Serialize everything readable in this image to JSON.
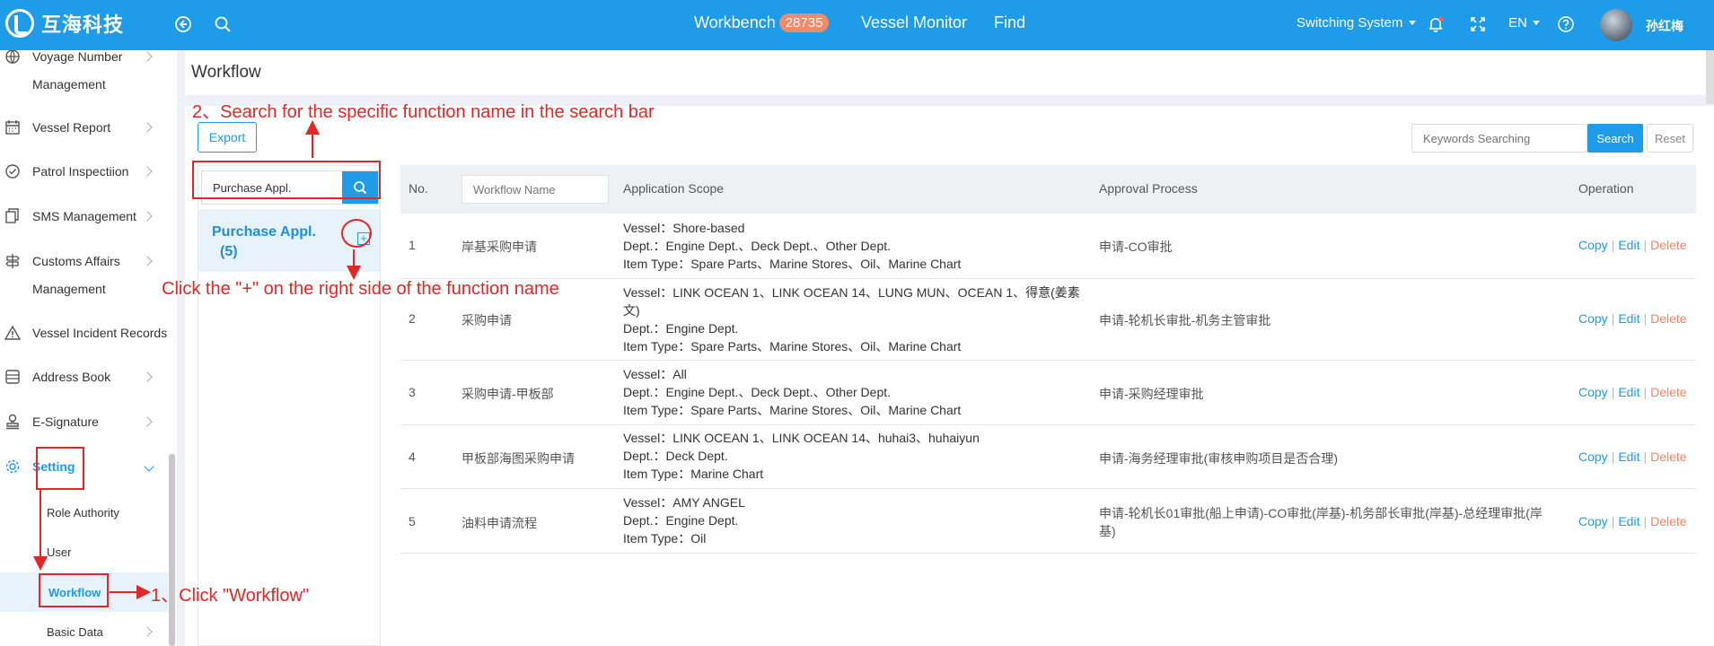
{
  "header": {
    "logo_text": "互海科技",
    "nav": {
      "workbench": "Workbench",
      "workbench_count": "28735",
      "vessel_monitor": "Vessel Monitor",
      "find": "Find"
    },
    "switching_system": "Switching System",
    "lang": "EN",
    "user_name": "孙红梅"
  },
  "sidebar": {
    "items": [
      {
        "label": "Voyage Number",
        "label2": "Management"
      },
      {
        "label": "Vessel Report"
      },
      {
        "label": "Patrol Inspectiion"
      },
      {
        "label": "SMS Management"
      },
      {
        "label": "Customs Affairs",
        "label2": "Management"
      },
      {
        "label": "Vessel Incident Records"
      },
      {
        "label": "Address Book"
      },
      {
        "label": "E-Signature"
      },
      {
        "label": "Setting"
      }
    ],
    "sub_items": [
      "Role Authority",
      "User",
      "Workflow",
      "Basic Data"
    ]
  },
  "page": {
    "title": "Workflow"
  },
  "toolbar": {
    "export_label": "Export",
    "keyword_placeholder": "Keywords Searching",
    "search_label": "Search",
    "reset_label": "Reset"
  },
  "function_panel": {
    "search_value": "Purchase Appl.",
    "item_name": "Purchase Appl.",
    "item_count": "(5)",
    "plus_symbol": "+"
  },
  "table": {
    "headers": {
      "no": "No.",
      "workflow_name_placeholder": "Workflow Name",
      "scope": "Application Scope",
      "approval": "Approval Process",
      "operation": "Operation"
    },
    "ops": {
      "copy": "Copy",
      "edit": "Edit",
      "delete": "Delete",
      "sep": "|"
    },
    "rows": [
      {
        "no": "1",
        "name": "岸基采购申请",
        "scope": [
          "Vessel：Shore-based",
          "Dept.：Engine Dept.、Deck Dept.、Other Dept.",
          "Item Type：Spare Parts、Marine Stores、Oil、Marine Chart"
        ],
        "approval": "申请-CO审批"
      },
      {
        "no": "2",
        "name": "采购申请",
        "scope": [
          "Vessel：LINK OCEAN 1、LINK OCEAN 14、LUNG MUN、OCEAN 1、得意(姜素",
          "文)",
          "Dept.：Engine Dept.",
          "Item Type：Spare Parts、Marine Stores、Oil、Marine Chart"
        ],
        "approval": "申请-轮机长审批-机务主管审批"
      },
      {
        "no": "3",
        "name": "采购申请-甲板部",
        "scope": [
          "Vessel：All",
          "Dept.：Engine Dept.、Deck Dept.、Other Dept.",
          "Item Type：Spare Parts、Marine Stores、Oil、Marine Chart"
        ],
        "approval": "申请-采购经理审批"
      },
      {
        "no": "4",
        "name": "甲板部海图采购申请",
        "scope": [
          "Vessel：LINK OCEAN 1、LINK OCEAN 14、huhai3、huhaiyun",
          "Dept.：Deck Dept.",
          "Item Type：Marine Chart"
        ],
        "approval": "申请-海务经理审批(审核申购项目是否合理)"
      },
      {
        "no": "5",
        "name": "油料申请流程",
        "scope": [
          "Vessel：AMY ANGEL",
          "Dept.：Engine Dept.",
          "Item Type：Oil"
        ],
        "approval": "申请-轮机长01审批(船上申请)-CO审批(岸基)-机务部长审批(岸基)-总经理审批(岸",
        "approval2": "基)"
      }
    ]
  },
  "annotations": {
    "step2": "2、Search for the specific function name in the search bar",
    "plus_hint": "Click the \"+\" on the right side of the function name",
    "step1": "1、Click \"Workflow\""
  },
  "colors": {
    "primary": "#1e9be9",
    "annotation": "#e32727",
    "delete": "#f0866a",
    "badge": "#f28a68"
  }
}
